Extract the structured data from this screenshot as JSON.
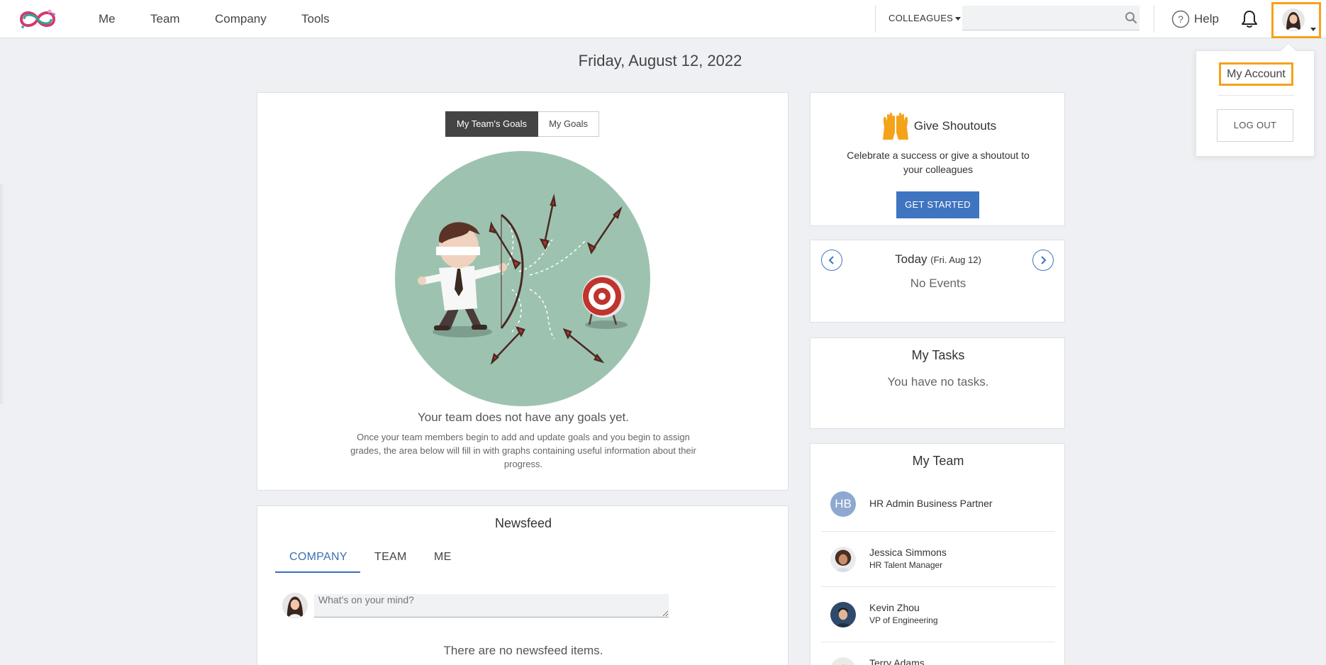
{
  "nav": {
    "links": [
      "Me",
      "Team",
      "Company",
      "Tools"
    ],
    "colleagues_label": "COLLEAGUES",
    "search_placeholder": "",
    "help_label": "Help"
  },
  "dropdown": {
    "my_account": "My Account",
    "logout": "LOG OUT"
  },
  "date": "Friday, August 12, 2022",
  "goals": {
    "tabs": [
      "My Team's Goals",
      "My Goals"
    ],
    "heading": "Your team does not have any goals yet.",
    "description": "Once your team members begin to add and update goals and you begin to assign grades, the area below will fill in with graphs containing useful information about their progress."
  },
  "newsfeed": {
    "title": "Newsfeed",
    "tabs": [
      "COMPANY",
      "TEAM",
      "ME"
    ],
    "input_placeholder": "What's on your mind?",
    "empty": "There are no newsfeed items."
  },
  "shoutouts": {
    "title": "Give Shoutouts",
    "description": "Celebrate a success or give a shoutout to your colleagues",
    "button": "GET STARTED"
  },
  "events": {
    "today": "Today",
    "date_suffix": "(Fri. Aug 12)",
    "empty": "No Events"
  },
  "tasks": {
    "title": "My Tasks",
    "empty": "You have no tasks."
  },
  "team": {
    "title": "My Team",
    "members": [
      {
        "initials": "HB",
        "name": "HR Admin Business Partner",
        "role": ""
      },
      {
        "name": "Jessica Simmons",
        "role": "HR Talent Manager"
      },
      {
        "name": "Kevin Zhou",
        "role": "VP of Engineering"
      },
      {
        "name": "Terry Adams",
        "role": ""
      }
    ]
  },
  "colors": {
    "accent_blue": "#3f74c0",
    "highlight_orange": "#f5a21b",
    "illustration_bg": "#9dc3b0"
  }
}
